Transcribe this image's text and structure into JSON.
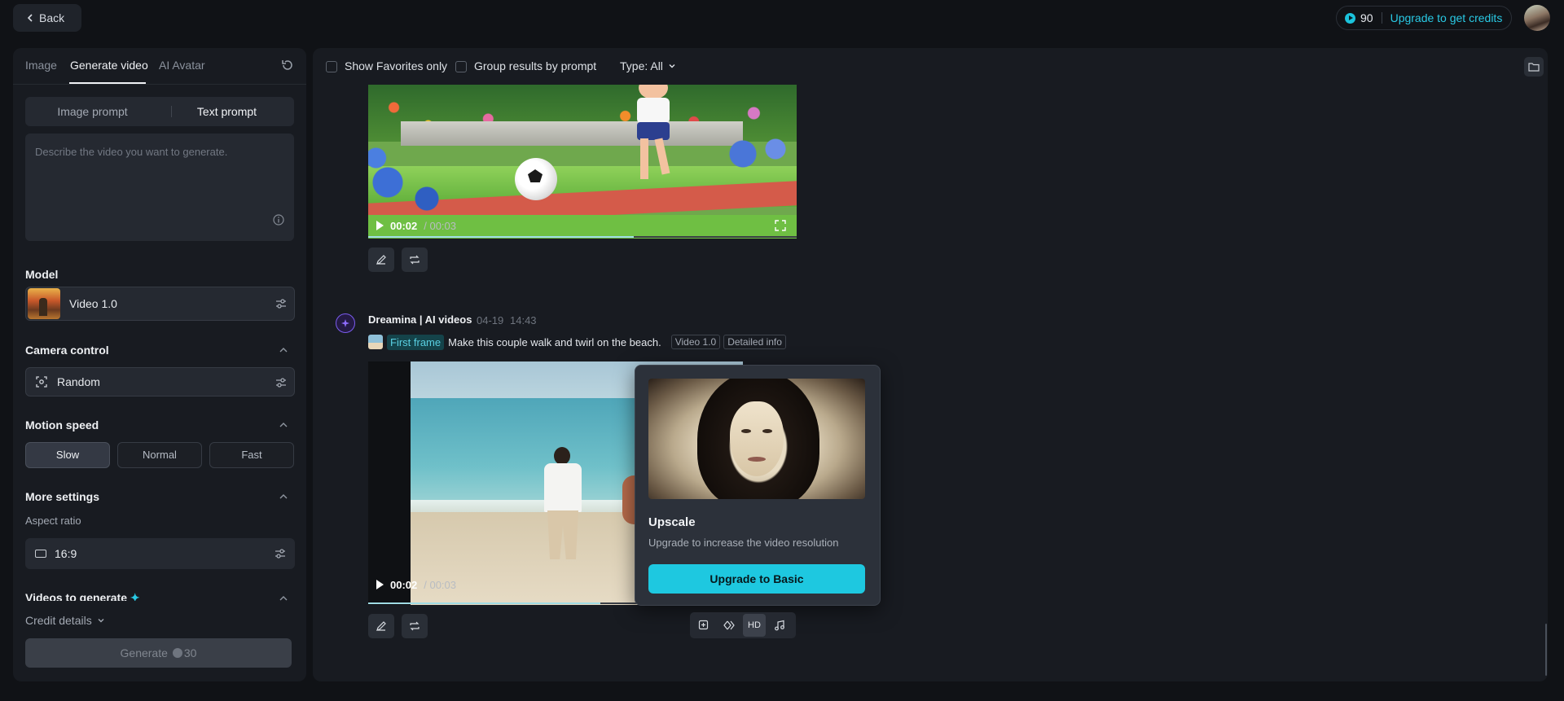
{
  "topbar": {
    "back_label": "Back",
    "credits": "90",
    "upgrade_label": "Upgrade to get credits"
  },
  "sidebar": {
    "tabs": [
      {
        "label": "Image",
        "active": false
      },
      {
        "label": "Generate video",
        "active": true
      },
      {
        "label": "AI Avatar",
        "active": false
      }
    ],
    "prompt_modes": [
      {
        "label": "Image prompt",
        "active": false
      },
      {
        "label": "Text prompt",
        "active": true
      }
    ],
    "prompt_placeholder": "Describe the video you want to generate.",
    "model": {
      "title": "Model",
      "value": "Video 1.0"
    },
    "camera": {
      "title": "Camera control",
      "value": "Random"
    },
    "motion": {
      "title": "Motion speed",
      "options": [
        "Slow",
        "Normal",
        "Fast"
      ],
      "selected": "Slow"
    },
    "more_settings": {
      "title": "More settings",
      "aspect_label": "Aspect ratio",
      "aspect_value": "16:9"
    },
    "videos_to_generate": "Videos to generate",
    "credit_details": "Credit details",
    "generate": {
      "label": "Generate",
      "cost": "30"
    }
  },
  "filters": {
    "favorites": "Show Favorites only",
    "group": "Group results by prompt",
    "type": "Type: All"
  },
  "video1": {
    "current_time": "00:02",
    "duration": "/ 00:03",
    "progress": 0.62
  },
  "entry": {
    "author": "Dreamina | AI videos",
    "date": "04-19",
    "time": "14:43",
    "first_frame_label": "First frame",
    "prompt": "Make this couple walk and twirl on the beach.",
    "model_tag": "Video 1.0",
    "details_tag": "Detailed info"
  },
  "video2": {
    "current_time": "00:02",
    "duration": "/ 00:03",
    "progress": 0.62
  },
  "popover": {
    "title": "Upscale",
    "description": "Upgrade to increase the video resolution",
    "button": "Upgrade to Basic"
  },
  "toolbar": {
    "hd_label": "HD"
  },
  "colors": {
    "accent": "#1ec8e0",
    "bot_avatar": "#7b5cf0",
    "first_frame_text": "#5ad0e2"
  }
}
